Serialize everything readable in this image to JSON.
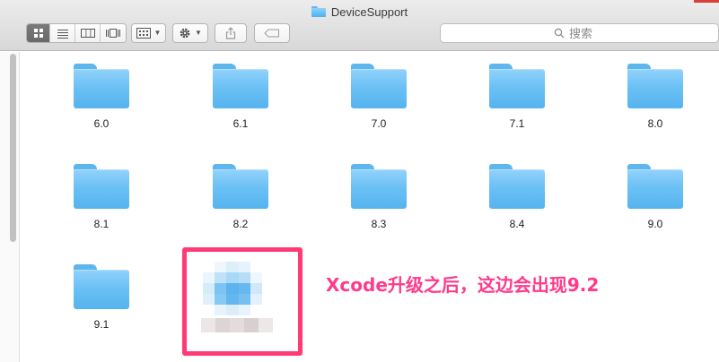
{
  "window": {
    "title": "DeviceSupport"
  },
  "toolbar": {
    "view_modes": [
      "icon-view",
      "list-view",
      "column-view",
      "cover-flow-view"
    ],
    "arrange_icon": "grid-arrange-icon",
    "action_icon": "gear-icon",
    "share_icon": "share-icon",
    "tag_icon": "tag-icon"
  },
  "search": {
    "placeholder": "搜索"
  },
  "folders": [
    {
      "name": "6.0"
    },
    {
      "name": "6.1"
    },
    {
      "name": "7.0"
    },
    {
      "name": "7.1"
    },
    {
      "name": "8.0"
    },
    {
      "name": "8.1"
    },
    {
      "name": "8.2"
    },
    {
      "name": "8.3"
    },
    {
      "name": "8.4"
    },
    {
      "name": "9.0"
    },
    {
      "name": "9.1"
    }
  ],
  "annotation": {
    "text": "Xcode升级之后，这边会出现9.2",
    "color": "#ff3a8a"
  },
  "colors": {
    "folder_blue": "#6cc1f5",
    "highlight": "#ff3a74"
  }
}
